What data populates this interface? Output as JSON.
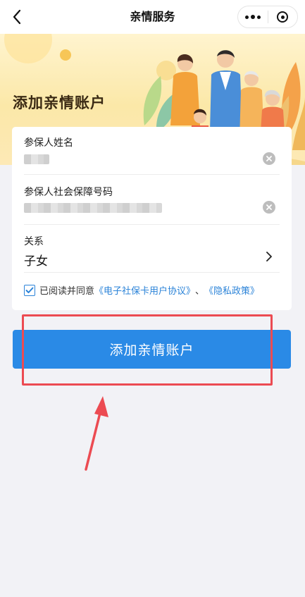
{
  "navbar": {
    "title": "亲情服务",
    "icons": {
      "back": "chevron-left-icon",
      "more": "more-dots-icon",
      "close": "target-icon"
    }
  },
  "banner": {
    "title": "添加亲情账户"
  },
  "form": {
    "name_field": {
      "label": "参保人姓名",
      "value_masked": true
    },
    "ssn_field": {
      "label": "参保人社会保障号码",
      "value_masked": true
    },
    "relation_field": {
      "label": "关系",
      "value": "子女"
    },
    "agreement": {
      "checked": true,
      "prefix": "已阅读并同意",
      "link1": "《电子社保卡用户协议》",
      "separator": "、",
      "link2": "《隐私政策》"
    }
  },
  "submit": {
    "label": "添加亲情账户"
  },
  "annotation": {
    "color": "#ec4b52"
  },
  "colors": {
    "accent": "#2a8ae6",
    "banner": "#fbe8a8"
  }
}
